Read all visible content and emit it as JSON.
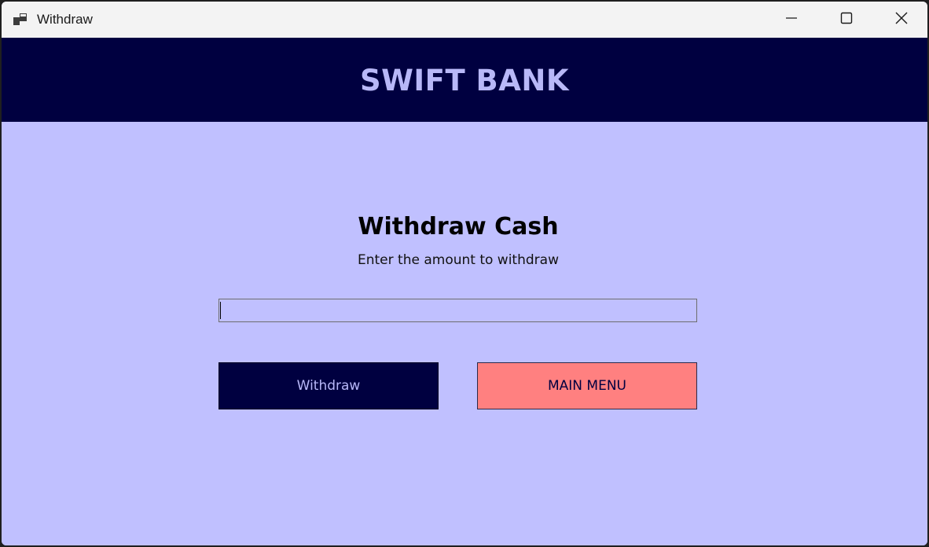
{
  "window": {
    "title": "Withdraw",
    "app_icon": "windows-form-icon",
    "controls": {
      "minimize_icon": "minimize-icon",
      "maximize_icon": "maximize-icon",
      "close_icon": "close-icon"
    }
  },
  "header": {
    "title": "SWIFT BANK"
  },
  "main": {
    "heading": "Withdraw Cash",
    "subheading": "Enter the amount to withdraw",
    "amount_input": {
      "value": "",
      "placeholder": ""
    },
    "withdraw_label": "Withdraw",
    "main_menu_label": "MAIN MENU"
  },
  "colors": {
    "header_bg": "#000040",
    "header_text": "#b8b8f8",
    "content_bg": "#c0c0ff",
    "withdraw_button_bg": "#000040",
    "main_menu_button_bg": "#ff8080"
  }
}
